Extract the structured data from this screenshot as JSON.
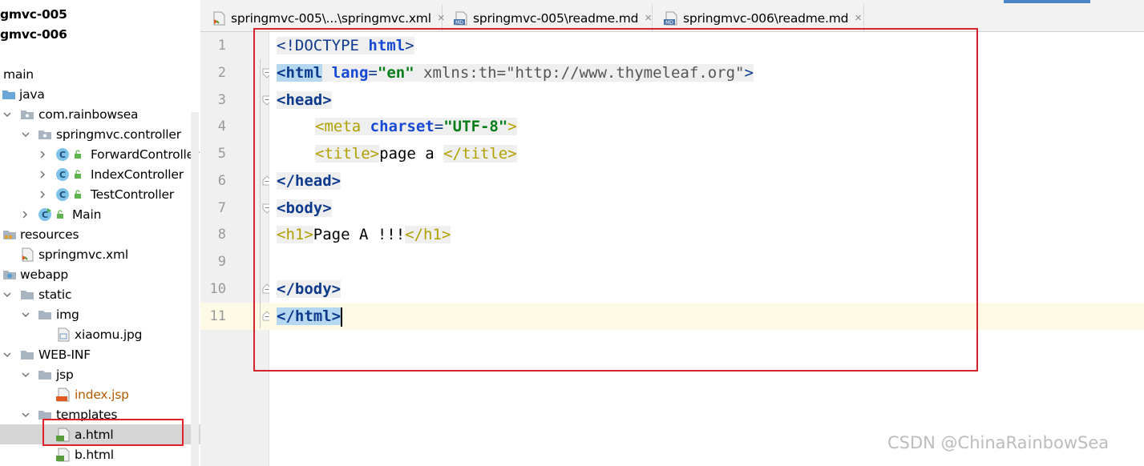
{
  "tree": {
    "items": [
      {
        "label": "gmvc-005",
        "bold": true
      },
      {
        "label": "gmvc-006",
        "bold": true
      },
      {
        "label": "main"
      },
      {
        "label": "java"
      },
      {
        "label": "com.rainbowsea"
      },
      {
        "label": "springmvc.controller"
      },
      {
        "label": "ForwardController"
      },
      {
        "label": "IndexController"
      },
      {
        "label": "TestController"
      },
      {
        "label": "Main"
      },
      {
        "label": "resources"
      },
      {
        "label": "springmvc.xml"
      },
      {
        "label": "webapp"
      },
      {
        "label": "static"
      },
      {
        "label": "img"
      },
      {
        "label": "xiaomu.jpg"
      },
      {
        "label": "WEB-INF"
      },
      {
        "label": "jsp"
      },
      {
        "label": "index.jsp"
      },
      {
        "label": "templates"
      },
      {
        "label": "a.html",
        "selected": true
      },
      {
        "label": "b.html"
      }
    ]
  },
  "tabs": [
    {
      "label": "springmvc-005\\...\\springmvc.xml",
      "icon": "xml-file-icon",
      "close": "×"
    },
    {
      "label": "springmvc-005\\readme.md",
      "icon": "md-file-icon",
      "close": "×"
    },
    {
      "label": "springmvc-006\\readme.md",
      "icon": "md-file-icon",
      "close": "×"
    }
  ],
  "editor": {
    "line_numbers": [
      "1",
      "2",
      "3",
      "4",
      "5",
      "6",
      "7",
      "8",
      "9",
      "10",
      "11"
    ],
    "current_line": "11",
    "code": {
      "l1_doctype": "<!DOCTYPE",
      "l1_html": "html",
      "l1_close": ">",
      "l2_open": "<html",
      "l2_attr1": "lang",
      "l2_eq1": "=",
      "l2_val1": "\"en\"",
      "l2_attr2": "xmlns:th",
      "l2_eq2": "=",
      "l2_val2": "\"http://www.thymeleaf.org\"",
      "l2_close": ">",
      "l3": "<head>",
      "l4_open": "<meta",
      "l4_attr": "charset",
      "l4_eq": "=",
      "l4_val": "\"UTF-8\"",
      "l4_close": ">",
      "l5_open": "<title>",
      "l5_text": "page a ",
      "l5_close": "</title>",
      "l6": "</head>",
      "l7": "<body>",
      "l8_open": "<h1>",
      "l8_text": "Page A !!!",
      "l8_close": "</h1>",
      "l10": "</body>",
      "l11": "</html>"
    }
  },
  "watermark": "CSDN @ChinaRainbowSea",
  "colors": {
    "tag": "#0d3a8c",
    "html_tag_yellow": "#b0a000",
    "attr": "#174ad4",
    "string": "#067d17",
    "annotation_box": "#d4242c"
  }
}
